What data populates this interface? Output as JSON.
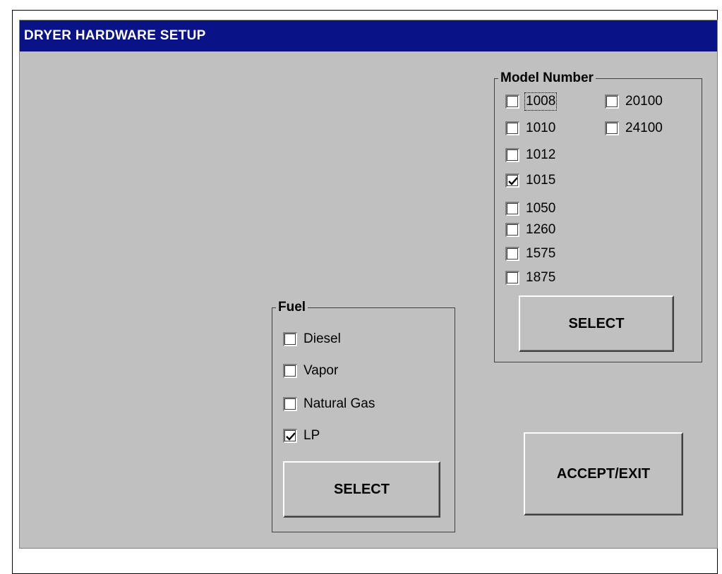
{
  "window": {
    "title": "DRYER HARDWARE SETUP"
  },
  "model_group": {
    "title": "Model Number",
    "options": [
      {
        "label": "1008",
        "checked": false,
        "focused": true
      },
      {
        "label": "1010",
        "checked": false
      },
      {
        "label": "1012",
        "checked": false
      },
      {
        "label": "1015",
        "checked": true
      },
      {
        "label": "1050",
        "checked": false
      },
      {
        "label": "1260",
        "checked": false
      },
      {
        "label": "1575",
        "checked": false
      },
      {
        "label": "1875",
        "checked": false
      },
      {
        "label": "20100",
        "checked": false
      },
      {
        "label": "24100",
        "checked": false
      }
    ],
    "select_label": "SELECT"
  },
  "fuel_group": {
    "title": "Fuel",
    "options": [
      {
        "label": "Diesel",
        "checked": false
      },
      {
        "label": "Vapor",
        "checked": false
      },
      {
        "label": "Natural Gas",
        "checked": false
      },
      {
        "label": "LP",
        "checked": true
      }
    ],
    "select_label": "SELECT"
  },
  "accept_exit_label": "ACCEPT/EXIT",
  "colors": {
    "titlebar": "#0a1287",
    "window_bg": "#c0c0c0"
  }
}
